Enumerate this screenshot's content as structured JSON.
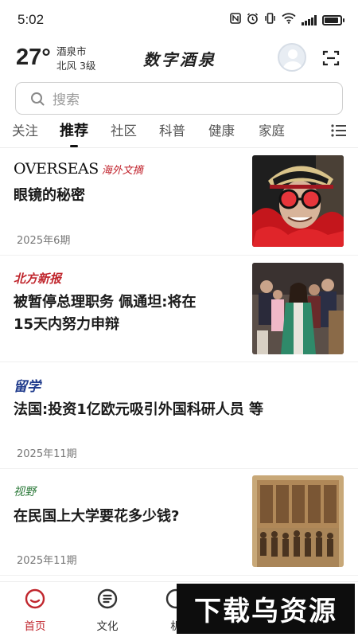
{
  "status_bar": {
    "time": "5:02",
    "icons": [
      "nfc-icon",
      "alarm-icon",
      "vibrate-icon",
      "wifi-icon",
      "signal-icon",
      "battery-icon"
    ],
    "battery_level": 0.9
  },
  "header": {
    "temperature": "27°",
    "city": "酒泉市",
    "wind": "北风  3级",
    "app_title": "数字酒泉"
  },
  "search": {
    "placeholder": "搜索"
  },
  "tabs": [
    {
      "label": "关注",
      "active": false
    },
    {
      "label": "推荐",
      "active": true
    },
    {
      "label": "社区",
      "active": false
    },
    {
      "label": "科普",
      "active": false
    },
    {
      "label": "健康",
      "active": false
    },
    {
      "label": "家庭",
      "active": false
    }
  ],
  "articles": [
    {
      "source_en": "OVERSEAS",
      "source_cn": "海外文摘",
      "title": "眼镜的秘密",
      "issue": "2025年6期",
      "has_image": true
    },
    {
      "source": "北方新报",
      "title_line1": "被暂停总理职务  佩通坦:将在",
      "title_line2": "15天内努力申辩",
      "has_image": true
    },
    {
      "source": "留学",
      "title": "法国:投资1亿欧元吸引外国科研人员 等",
      "issue": "2025年11期",
      "has_image": false
    },
    {
      "source": "视野",
      "title": "在民国上大学要花多少钱?",
      "issue": "2025年11期",
      "has_image": true
    }
  ],
  "bottom_nav": [
    {
      "label": "首页",
      "active": true
    },
    {
      "label": "文化",
      "active": false
    },
    {
      "label": "机",
      "active": false
    }
  ],
  "watermark": "下载乌资源",
  "colors": {
    "accent_red": "#c0262d",
    "liuxue_blue": "#1e3a8c",
    "shiye_green": "#2c7a3a"
  }
}
